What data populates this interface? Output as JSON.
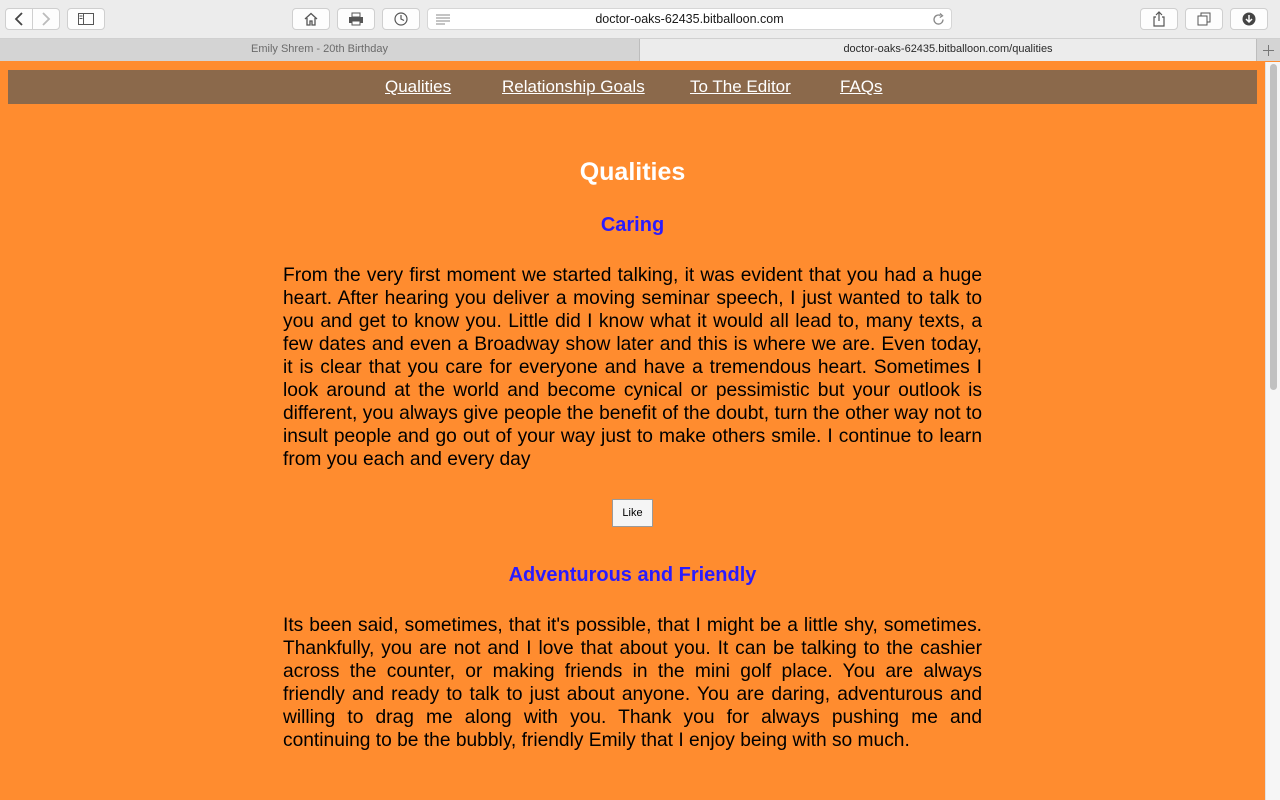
{
  "browser": {
    "url": "doctor-oaks-62435.bitballoon.com",
    "tabs": [
      {
        "title": "Emily Shrem - 20th Birthday",
        "active": false
      },
      {
        "title": "doctor-oaks-62435.bitballoon.com/qualities",
        "active": true
      }
    ],
    "icons": [
      "back-icon",
      "forward-icon",
      "sidebar-icon",
      "home-icon",
      "print-icon",
      "history-icon",
      "reader-icon",
      "reload-icon",
      "share-icon",
      "tabs-overview-icon",
      "downloads-icon",
      "new-tab-icon"
    ]
  },
  "colors": {
    "page_background": "#ff8c2f",
    "navbar_background": "#8b694b",
    "section_title": "#2a1bff",
    "heading": "#ffffff"
  },
  "nav": {
    "items": [
      {
        "label": "Qualities"
      },
      {
        "label": "Relationship Goals"
      },
      {
        "label": "To The Editor"
      },
      {
        "label": "FAQs"
      }
    ]
  },
  "page": {
    "title": "Qualities",
    "sections": [
      {
        "title": "Caring",
        "text": "From the very first moment we started talking, it was evident that you had a huge heart. After hearing you deliver a moving seminar speech, I just wanted to talk to you and get to know you. Little did I know what it would all lead to, many texts, a few dates and even a Broadway show later and this is where we are. Even today, it is clear that you care for everyone and have a tremendous heart. Sometimes I look around at the world and become cynical or pessimistic but your outlook is different, you always give people the benefit of the doubt, turn the other way not to insult people and go out of your way just to make others smile. I continue to learn from you each and every day",
        "like_label": "Like"
      },
      {
        "title": "Adventurous and Friendly",
        "text": "Its been said, sometimes, that it's possible, that I might be a little shy, sometimes. Thankfully, you are not and I love that about you. It can be talking to the cashier across the counter, or making friends in the mini golf place. You are always friendly and ready to talk to just about anyone. You are daring, adventurous and willing to drag me along with you. Thank you for always pushing me and continuing to be the bubbly, friendly Emily that I enjoy being with so much."
      }
    ]
  }
}
